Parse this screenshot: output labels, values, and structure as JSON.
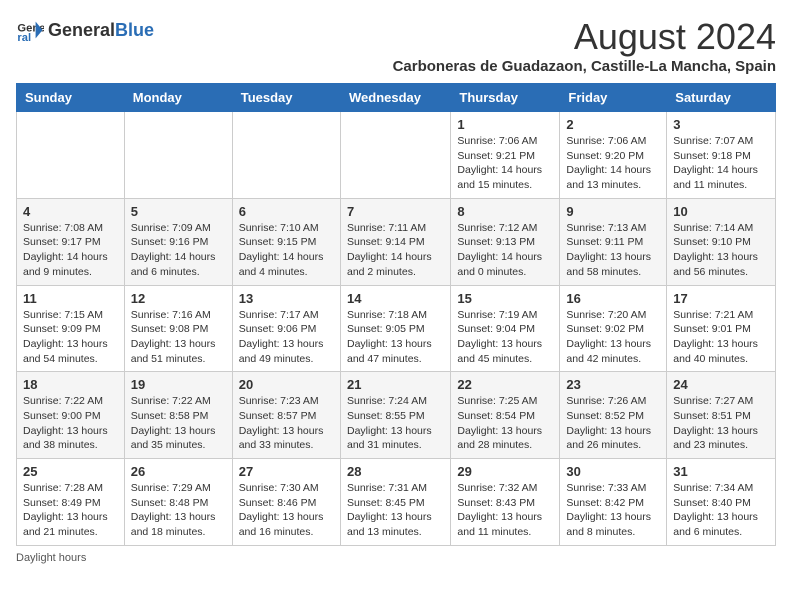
{
  "header": {
    "logo_general": "General",
    "logo_blue": "Blue",
    "month_title": "August 2024",
    "subtitle": "Carboneras de Guadazaon, Castille-La Mancha, Spain"
  },
  "days_of_week": [
    "Sunday",
    "Monday",
    "Tuesday",
    "Wednesday",
    "Thursday",
    "Friday",
    "Saturday"
  ],
  "weeks": [
    [
      {
        "day": "",
        "info": ""
      },
      {
        "day": "",
        "info": ""
      },
      {
        "day": "",
        "info": ""
      },
      {
        "day": "",
        "info": ""
      },
      {
        "day": "1",
        "info": "Sunrise: 7:06 AM\nSunset: 9:21 PM\nDaylight: 14 hours\nand 15 minutes."
      },
      {
        "day": "2",
        "info": "Sunrise: 7:06 AM\nSunset: 9:20 PM\nDaylight: 14 hours\nand 13 minutes."
      },
      {
        "day": "3",
        "info": "Sunrise: 7:07 AM\nSunset: 9:18 PM\nDaylight: 14 hours\nand 11 minutes."
      }
    ],
    [
      {
        "day": "4",
        "info": "Sunrise: 7:08 AM\nSunset: 9:17 PM\nDaylight: 14 hours\nand 9 minutes."
      },
      {
        "day": "5",
        "info": "Sunrise: 7:09 AM\nSunset: 9:16 PM\nDaylight: 14 hours\nand 6 minutes."
      },
      {
        "day": "6",
        "info": "Sunrise: 7:10 AM\nSunset: 9:15 PM\nDaylight: 14 hours\nand 4 minutes."
      },
      {
        "day": "7",
        "info": "Sunrise: 7:11 AM\nSunset: 9:14 PM\nDaylight: 14 hours\nand 2 minutes."
      },
      {
        "day": "8",
        "info": "Sunrise: 7:12 AM\nSunset: 9:13 PM\nDaylight: 14 hours\nand 0 minutes."
      },
      {
        "day": "9",
        "info": "Sunrise: 7:13 AM\nSunset: 9:11 PM\nDaylight: 13 hours\nand 58 minutes."
      },
      {
        "day": "10",
        "info": "Sunrise: 7:14 AM\nSunset: 9:10 PM\nDaylight: 13 hours\nand 56 minutes."
      }
    ],
    [
      {
        "day": "11",
        "info": "Sunrise: 7:15 AM\nSunset: 9:09 PM\nDaylight: 13 hours\nand 54 minutes."
      },
      {
        "day": "12",
        "info": "Sunrise: 7:16 AM\nSunset: 9:08 PM\nDaylight: 13 hours\nand 51 minutes."
      },
      {
        "day": "13",
        "info": "Sunrise: 7:17 AM\nSunset: 9:06 PM\nDaylight: 13 hours\nand 49 minutes."
      },
      {
        "day": "14",
        "info": "Sunrise: 7:18 AM\nSunset: 9:05 PM\nDaylight: 13 hours\nand 47 minutes."
      },
      {
        "day": "15",
        "info": "Sunrise: 7:19 AM\nSunset: 9:04 PM\nDaylight: 13 hours\nand 45 minutes."
      },
      {
        "day": "16",
        "info": "Sunrise: 7:20 AM\nSunset: 9:02 PM\nDaylight: 13 hours\nand 42 minutes."
      },
      {
        "day": "17",
        "info": "Sunrise: 7:21 AM\nSunset: 9:01 PM\nDaylight: 13 hours\nand 40 minutes."
      }
    ],
    [
      {
        "day": "18",
        "info": "Sunrise: 7:22 AM\nSunset: 9:00 PM\nDaylight: 13 hours\nand 38 minutes."
      },
      {
        "day": "19",
        "info": "Sunrise: 7:22 AM\nSunset: 8:58 PM\nDaylight: 13 hours\nand 35 minutes."
      },
      {
        "day": "20",
        "info": "Sunrise: 7:23 AM\nSunset: 8:57 PM\nDaylight: 13 hours\nand 33 minutes."
      },
      {
        "day": "21",
        "info": "Sunrise: 7:24 AM\nSunset: 8:55 PM\nDaylight: 13 hours\nand 31 minutes."
      },
      {
        "day": "22",
        "info": "Sunrise: 7:25 AM\nSunset: 8:54 PM\nDaylight: 13 hours\nand 28 minutes."
      },
      {
        "day": "23",
        "info": "Sunrise: 7:26 AM\nSunset: 8:52 PM\nDaylight: 13 hours\nand 26 minutes."
      },
      {
        "day": "24",
        "info": "Sunrise: 7:27 AM\nSunset: 8:51 PM\nDaylight: 13 hours\nand 23 minutes."
      }
    ],
    [
      {
        "day": "25",
        "info": "Sunrise: 7:28 AM\nSunset: 8:49 PM\nDaylight: 13 hours\nand 21 minutes."
      },
      {
        "day": "26",
        "info": "Sunrise: 7:29 AM\nSunset: 8:48 PM\nDaylight: 13 hours\nand 18 minutes."
      },
      {
        "day": "27",
        "info": "Sunrise: 7:30 AM\nSunset: 8:46 PM\nDaylight: 13 hours\nand 16 minutes."
      },
      {
        "day": "28",
        "info": "Sunrise: 7:31 AM\nSunset: 8:45 PM\nDaylight: 13 hours\nand 13 minutes."
      },
      {
        "day": "29",
        "info": "Sunrise: 7:32 AM\nSunset: 8:43 PM\nDaylight: 13 hours\nand 11 minutes."
      },
      {
        "day": "30",
        "info": "Sunrise: 7:33 AM\nSunset: 8:42 PM\nDaylight: 13 hours\nand 8 minutes."
      },
      {
        "day": "31",
        "info": "Sunrise: 7:34 AM\nSunset: 8:40 PM\nDaylight: 13 hours\nand 6 minutes."
      }
    ]
  ],
  "footer": {
    "note": "Daylight hours"
  }
}
